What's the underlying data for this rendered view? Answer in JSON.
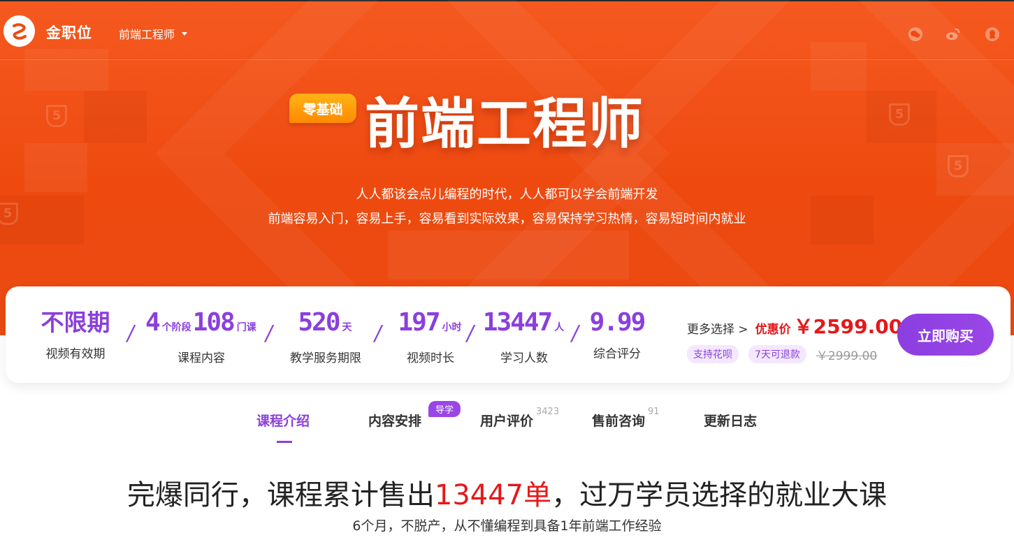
{
  "nav": {
    "brand": "金职位",
    "course_selector": "前端工程师",
    "social_icons": [
      "wechat-icon",
      "weibo-icon",
      "qq-icon"
    ]
  },
  "hero": {
    "badge": "零基础",
    "title": "前端工程师",
    "subtitle_line1": "人人都该会点儿编程的时代，人人都可以学会前端开发",
    "subtitle_line2": "前端容易入门，容易上手，容易看到实际效果，容易保持学习热情，容易短时间内就业"
  },
  "stats": {
    "validity": {
      "value": "不限期",
      "label": "视频有效期"
    },
    "content": {
      "stages": "4",
      "stages_unit": "个阶段",
      "lessons": "108",
      "lessons_unit": "门课",
      "label": "课程内容"
    },
    "service": {
      "value": "520",
      "unit": "天",
      "label": "教学服务期限"
    },
    "duration": {
      "value": "197",
      "unit": "小时",
      "label": "视频时长"
    },
    "learners": {
      "value": "13447",
      "unit": "人",
      "label": "学习人数"
    },
    "rating": {
      "value": "9.99",
      "label": "综合评分"
    }
  },
  "pricing": {
    "more_choice": "更多选择 >",
    "discount_label": "优惠价",
    "price": "￥2599.00",
    "tag_huabei": "支持花呗",
    "tag_refund": "7天可退款",
    "original_price": "￥2999.00",
    "buy_label": "立即购买"
  },
  "tabs": {
    "intro": "课程介绍",
    "schedule": "内容安排",
    "schedule_badge": "导学",
    "reviews": "用户评价",
    "reviews_count": "3423",
    "presale": "售前咨询",
    "presale_count": "91",
    "changelog": "更新日志"
  },
  "content": {
    "headline_prefix": "完爆同行，课程累计售出",
    "headline_number": "13447单",
    "headline_suffix": "，过万学员选择的就业大课",
    "subline": "6个月，不脱产，从不懂编程到具备1年前端工作经验"
  },
  "colors": {
    "hero_orange": "#ee4a10",
    "accent_purple": "#8b3fdc",
    "price_red": "#e4181a",
    "badge_yellow": "#ff9a00"
  }
}
